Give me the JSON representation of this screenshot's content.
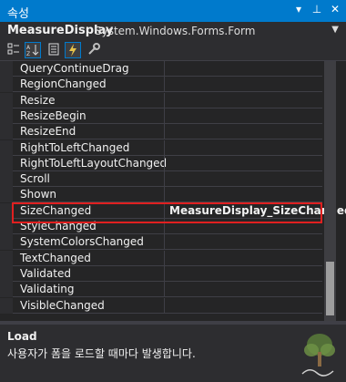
{
  "window": {
    "title": "속성",
    "dropdown_icon": "▾",
    "pin_icon": "⊥",
    "close_icon": "✕"
  },
  "object": {
    "name": "MeasureDisplay",
    "type": "System.Windows.Forms.Form"
  },
  "toolbar": {
    "categorized": "categorized-icon",
    "alphabetical": "alphabetical-icon",
    "properties": "properties-icon",
    "events": "events-icon",
    "property_pages": "wrench-icon"
  },
  "events": [
    {
      "name": "QueryContinueDrag",
      "value": ""
    },
    {
      "name": "RegionChanged",
      "value": ""
    },
    {
      "name": "Resize",
      "value": ""
    },
    {
      "name": "ResizeBegin",
      "value": ""
    },
    {
      "name": "ResizeEnd",
      "value": ""
    },
    {
      "name": "RightToLeftChanged",
      "value": ""
    },
    {
      "name": "RightToLeftLayoutChanged",
      "value": ""
    },
    {
      "name": "Scroll",
      "value": ""
    },
    {
      "name": "Shown",
      "value": ""
    },
    {
      "name": "SizeChanged",
      "value": "MeasureDisplay_SizeChanged"
    },
    {
      "name": "StyleChanged",
      "value": ""
    },
    {
      "name": "SystemColorsChanged",
      "value": ""
    },
    {
      "name": "TextChanged",
      "value": ""
    },
    {
      "name": "Validated",
      "value": ""
    },
    {
      "name": "Validating",
      "value": ""
    },
    {
      "name": "VisibleChanged",
      "value": ""
    }
  ],
  "description": {
    "title": "Load",
    "text": "사용자가 폼을 로드할 때마다 발생합니다."
  },
  "colors": {
    "accent": "#007acc",
    "highlight_border": "#e02020",
    "background": "#252526"
  }
}
